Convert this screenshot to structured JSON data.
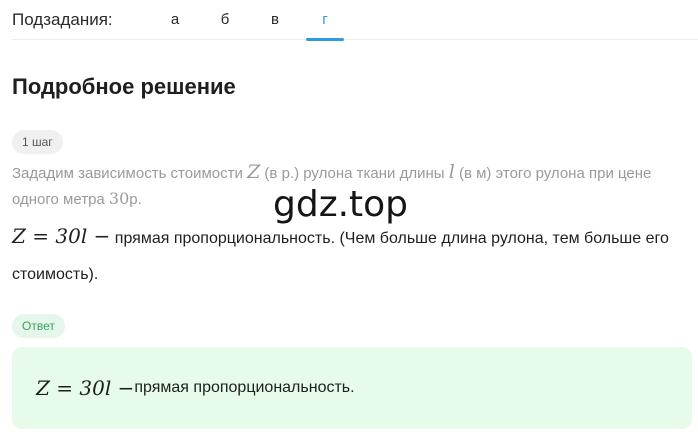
{
  "subtasks": {
    "label": "Подзадания:",
    "tabs": [
      {
        "label": "а"
      },
      {
        "label": "б"
      },
      {
        "label": "в"
      },
      {
        "label": "г"
      }
    ],
    "active_index": 3
  },
  "solution": {
    "title": "Подробное решение",
    "step_badge": "1 шаг",
    "step_text": {
      "p1": "Зададим зависимость стоимости ",
      "var_z": "Z",
      "p2": " (в р.) рулона ткани длины ",
      "var_l": "l",
      "p3": " (в м) этого рулона при цене одного метра ",
      "price": "30",
      "p4": "р."
    },
    "formula": "Z = 30l −",
    "main_text": " прямая пропорциональность. (Чем больше длина рулона, тем больше его стоимость)."
  },
  "watermark": "gdz.top",
  "answer": {
    "badge": "Ответ",
    "formula": "Z = 30l −",
    "text": " прямая пропорциональность."
  },
  "colors": {
    "accent": "#2f9be0",
    "answer_bg": "#e6fbe9",
    "answer_badge_text": "#3aa062"
  }
}
